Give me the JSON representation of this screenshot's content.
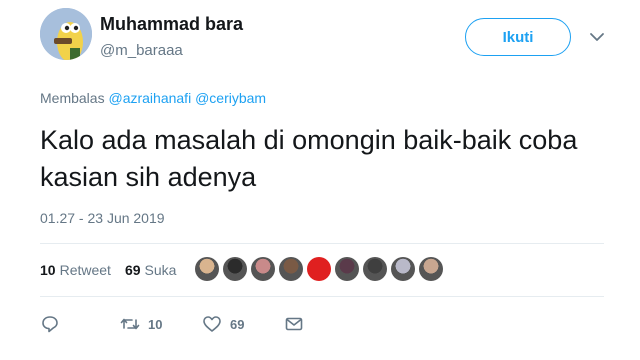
{
  "user": {
    "name": "Muhammad bara",
    "handle": "@m_baraaa"
  },
  "follow_label": "Ikuti",
  "reply": {
    "prefix": "Membalas",
    "mentions": [
      "@azraihanafi",
      "@ceriybam"
    ]
  },
  "tweet_text": "Kalo ada masalah di omongin baik-baik coba kasian sih adenya",
  "timestamp": "01.27 - 23 Jun 2019",
  "stats": {
    "retweets_count": "10",
    "retweets_label": "Retweet",
    "likes_count": "69",
    "likes_label": "Suka"
  },
  "liker_colors": [
    "#d9b48f",
    "#2b2b2b",
    "#c98a8a",
    "#7a5a45",
    "#e02020",
    "#5a3a4a",
    "#3f3f3f",
    "#b9b9c9",
    "#c8a690"
  ],
  "actions": {
    "reply_count": "",
    "retweet_count": "10",
    "like_count": "69"
  },
  "colors": {
    "accent": "#1da1f2",
    "muted": "#657786"
  }
}
